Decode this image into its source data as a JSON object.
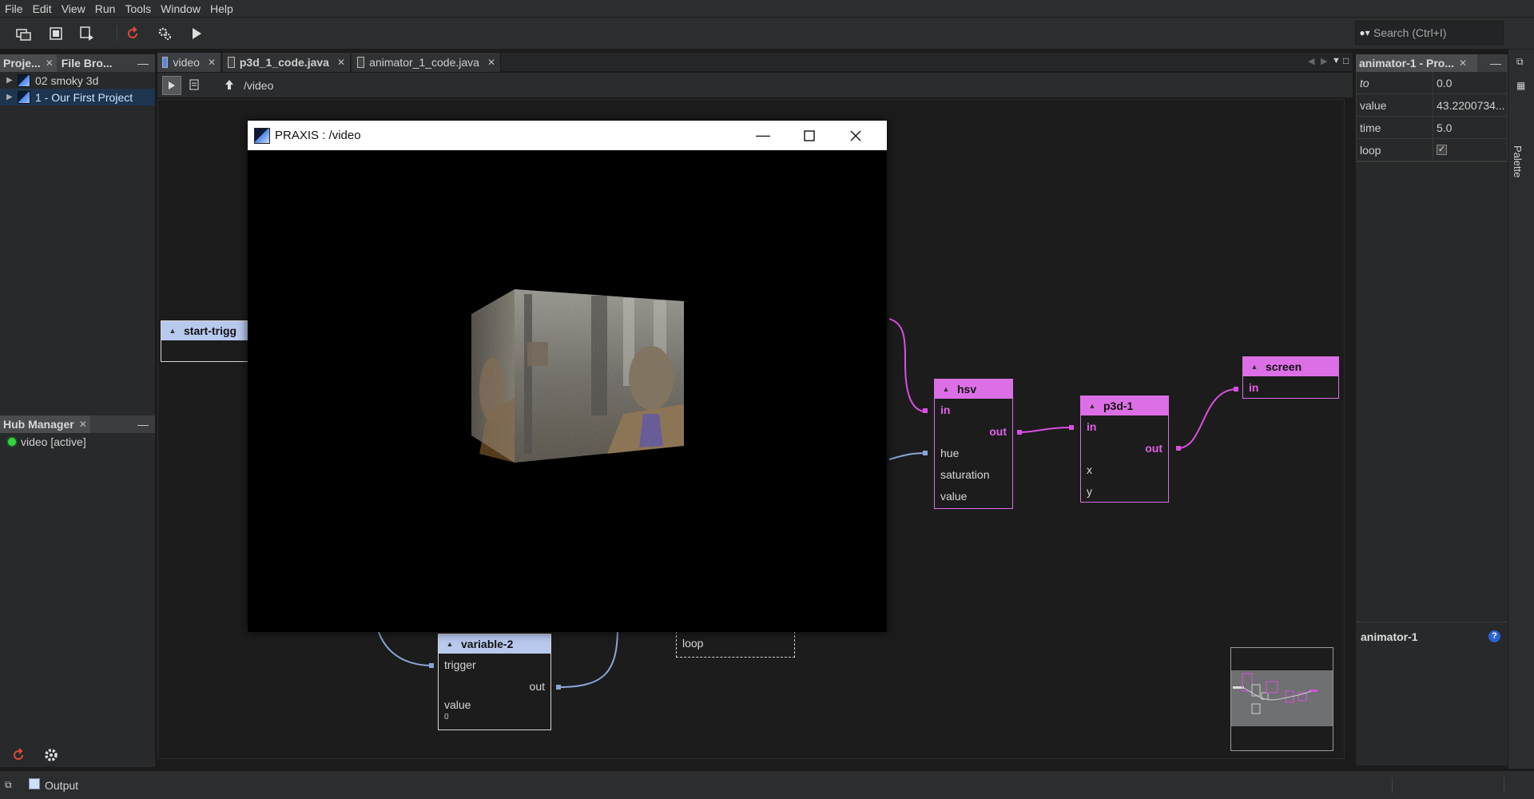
{
  "menu": [
    "File",
    "Edit",
    "View",
    "Run",
    "Tools",
    "Window",
    "Help"
  ],
  "search": {
    "placeholder": "Search (Ctrl+I)"
  },
  "projects_panel": {
    "tabs": [
      "Proje...",
      "File Bro..."
    ],
    "items": [
      {
        "label": "02 smoky 3d",
        "selected": false
      },
      {
        "label": "1 - Our First Project",
        "selected": true
      }
    ]
  },
  "hub_panel": {
    "title": "Hub Manager",
    "items": [
      {
        "label": "video [active]",
        "status_color": "#2fd83a"
      }
    ]
  },
  "editor": {
    "tabs": [
      {
        "label": "video",
        "active": true
      },
      {
        "label": "p3d_1_code.java",
        "active": false
      },
      {
        "label": "animator_1_code.java",
        "active": false
      }
    ],
    "path": "/video"
  },
  "nodes": {
    "start_trigger": {
      "title": "start-trigg"
    },
    "hsv": {
      "title": "hsv",
      "ports": [
        "in",
        "out",
        "hue",
        "saturation",
        "value"
      ]
    },
    "p3d": {
      "title": "p3d-1",
      "ports": [
        "in",
        "out",
        "x",
        "y"
      ]
    },
    "screen": {
      "title": "screen",
      "ports": [
        "in"
      ]
    },
    "variable": {
      "title": "variable-2",
      "ports": [
        "trigger",
        "out",
        "value"
      ],
      "value": "0"
    },
    "animator": {
      "ports": [
        "loop"
      ]
    }
  },
  "video_window": {
    "title": "PRAXIS : /video"
  },
  "properties": {
    "tab_title": "animator-1 - Pro...",
    "rows": [
      {
        "key": "to",
        "value": "0.0"
      },
      {
        "key": "value",
        "value": "43.2200734..."
      },
      {
        "key": "time",
        "value": "5.0"
      },
      {
        "key": "loop",
        "value": ""
      }
    ],
    "footer_title": "animator-1"
  },
  "palette": {
    "label": "Palette"
  },
  "status": {
    "output_label": "Output"
  }
}
